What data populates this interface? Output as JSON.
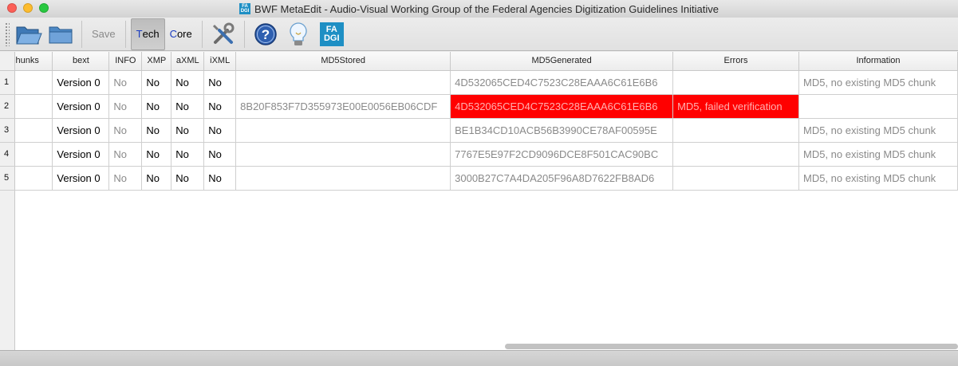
{
  "window": {
    "title": "BWF MetaEdit - Audio-Visual Working Group of the Federal Agencies Digitization Guidelines Initiative",
    "icon_text_top": "FA",
    "icon_text_bottom": "DGI"
  },
  "toolbar": {
    "open_file_icon": "open-file-icon",
    "open_folder_icon": "open-folder-icon",
    "save_label": "Save",
    "tech_label_first": "T",
    "tech_label_rest": "ech",
    "core_label_first": "C",
    "core_label_rest": "ore",
    "fadgi_top": "FA",
    "fadgi_bottom": "DGI",
    "help_glyph": "?"
  },
  "table": {
    "columns": [
      "hunks",
      "bext",
      "INFO",
      "XMP",
      "aXML",
      "iXML",
      "MD5Stored",
      "MD5Generated",
      "Errors",
      "Information"
    ],
    "rows": [
      {
        "num": "1",
        "chunks": "",
        "bext": "Version 0",
        "info": "No",
        "xmp": "No",
        "axml": "No",
        "ixml": "No",
        "md5stored": "",
        "md5generated": "4D532065CED4C7523C28EAAA6C61E6B6",
        "errors": "",
        "information": "MD5, no existing MD5 chunk"
      },
      {
        "num": "2",
        "chunks": "",
        "bext": "Version 0",
        "info": "No",
        "xmp": "No",
        "axml": "No",
        "ixml": "No",
        "md5stored": "8B20F853F7D355973E00E0056EB06CDF",
        "md5generated": "4D532065CED4C7523C28EAAA6C61E6B6",
        "errors": "MD5, failed verification",
        "information": ""
      },
      {
        "num": "3",
        "chunks": "",
        "bext": "Version 0",
        "info": "No",
        "xmp": "No",
        "axml": "No",
        "ixml": "No",
        "md5stored": "",
        "md5generated": "BE1B34CD10ACB56B3990CE78AF00595E",
        "errors": "",
        "information": "MD5, no existing MD5 chunk"
      },
      {
        "num": "4",
        "chunks": "",
        "bext": "Version 0",
        "info": "No",
        "xmp": "No",
        "axml": "No",
        "ixml": "No",
        "md5stored": "",
        "md5generated": "7767E5E97F2CD9096DCE8F501CAC90BC",
        "errors": "",
        "information": "MD5, no existing MD5 chunk"
      },
      {
        "num": "5",
        "chunks": "",
        "bext": "Version 0",
        "info": "No",
        "xmp": "No",
        "axml": "No",
        "ixml": "No",
        "md5stored": "",
        "md5generated": "3000B27C7A4DA205F96A8D7622FB8AD6",
        "errors": "",
        "information": "MD5, no existing MD5 chunk"
      }
    ]
  },
  "colors": {
    "error_red": "#ff0000",
    "traffic_close": "#fc5f57",
    "traffic_min": "#fdbc2e",
    "traffic_max": "#28c840",
    "fadgi_blue": "#1e8fc4"
  }
}
